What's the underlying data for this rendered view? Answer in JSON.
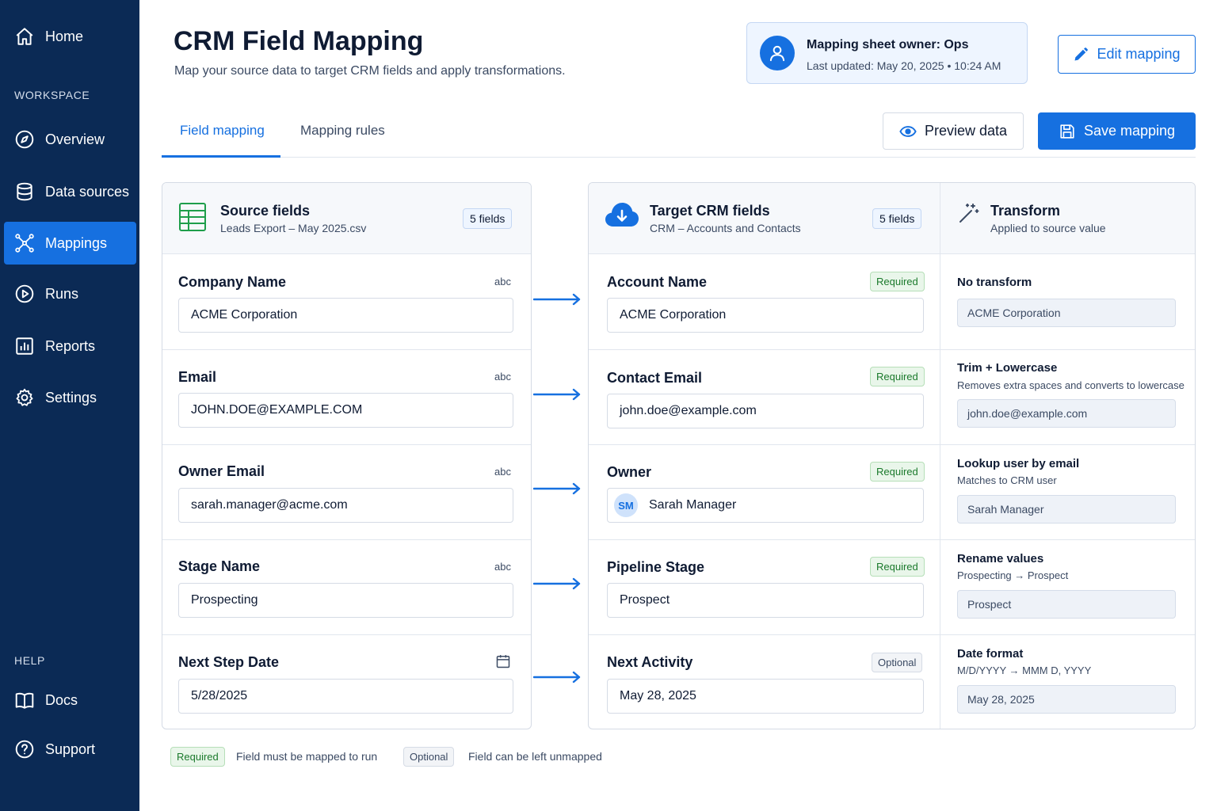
{
  "sidebar": {
    "home": "Home",
    "workspace_label": "WORKSPACE",
    "items": [
      {
        "label": "Overview",
        "icon": "compass-icon"
      },
      {
        "label": "Data sources",
        "icon": "database-icon"
      },
      {
        "label": "Mappings",
        "icon": "mappings-icon",
        "active": true
      },
      {
        "label": "Runs",
        "icon": "play-circle-icon"
      },
      {
        "label": "Reports",
        "icon": "bar-chart-icon"
      },
      {
        "label": "Settings",
        "icon": "gear-icon"
      }
    ],
    "help_label": "HELP",
    "help_items": [
      {
        "label": "Docs",
        "icon": "book-icon"
      },
      {
        "label": "Support",
        "icon": "question-circle-icon"
      }
    ]
  },
  "header": {
    "title": "CRM Field Mapping",
    "subtitle": "Map your source data to target CRM fields and apply transformations.",
    "owner": "Mapping sheet owner: Ops",
    "last_updated": "Last updated: May 20, 2025 • 10:24 AM",
    "edit_label": "Edit mapping"
  },
  "tabs": {
    "field_mapping": "Field mapping",
    "mapping_rules": "Mapping rules",
    "active": "field_mapping"
  },
  "actions": {
    "preview": "Preview data",
    "save": "Save mapping"
  },
  "source": {
    "title": "Source fields",
    "subtitle": "Leads Export – May 2025.csv",
    "count": "5 fields",
    "fields": [
      {
        "label": "Company Name",
        "type": "abc",
        "value": "ACME Corporation"
      },
      {
        "label": "Email",
        "type": "abc",
        "value": "JOHN.DOE@EXAMPLE.COM"
      },
      {
        "label": "Owner Email",
        "type": "abc",
        "value": "sarah.manager@acme.com"
      },
      {
        "label": "Stage Name",
        "type": "abc",
        "value": "Prospecting"
      },
      {
        "label": "Next Step Date",
        "type": "calendar-icon",
        "value": "5/28/2025"
      }
    ]
  },
  "target": {
    "title": "Target CRM fields",
    "subtitle": "CRM – Accounts and Contacts",
    "count": "5 fields",
    "fields": [
      {
        "label": "Account Name",
        "badge": "Required",
        "value": "ACME Corporation"
      },
      {
        "label": "Contact Email",
        "badge": "Required",
        "value": "john.doe@example.com"
      },
      {
        "label": "Owner",
        "badge": "Required",
        "value": "Sarah Manager",
        "avatar": "SM"
      },
      {
        "label": "Pipeline Stage",
        "badge": "Required",
        "value": "Prospect"
      },
      {
        "label": "Next Activity",
        "badge": "Optional",
        "value": "May 28, 2025"
      }
    ]
  },
  "transform": {
    "title": "Transform",
    "subtitle": "Applied to source value",
    "rows": [
      {
        "title": "No transform",
        "desc": "",
        "value": "ACME Corporation"
      },
      {
        "title": "Trim + Lowercase",
        "desc": "Removes extra spaces and converts to lowercase",
        "value": "john.doe@example.com"
      },
      {
        "title": "Lookup user by email",
        "desc": "Matches to CRM user",
        "value": "Sarah Manager"
      },
      {
        "title": "Rename values",
        "desc": "Prospecting → Prospect",
        "value": "Prospect"
      },
      {
        "title": "Date format",
        "desc": "M/D/YYYY → MMM D, YYYY",
        "value": "May 28, 2025"
      }
    ]
  },
  "legend": {
    "required_badge": "Required",
    "required_text": "Field must be mapped to run",
    "optional_badge": "Optional",
    "optional_text": "Field can be left unmapped"
  },
  "colors": {
    "sidebar": "#0b2a55",
    "accent": "#1670e0",
    "required": "#1b7a2c",
    "sheet_icon": "#1e9e4a"
  }
}
